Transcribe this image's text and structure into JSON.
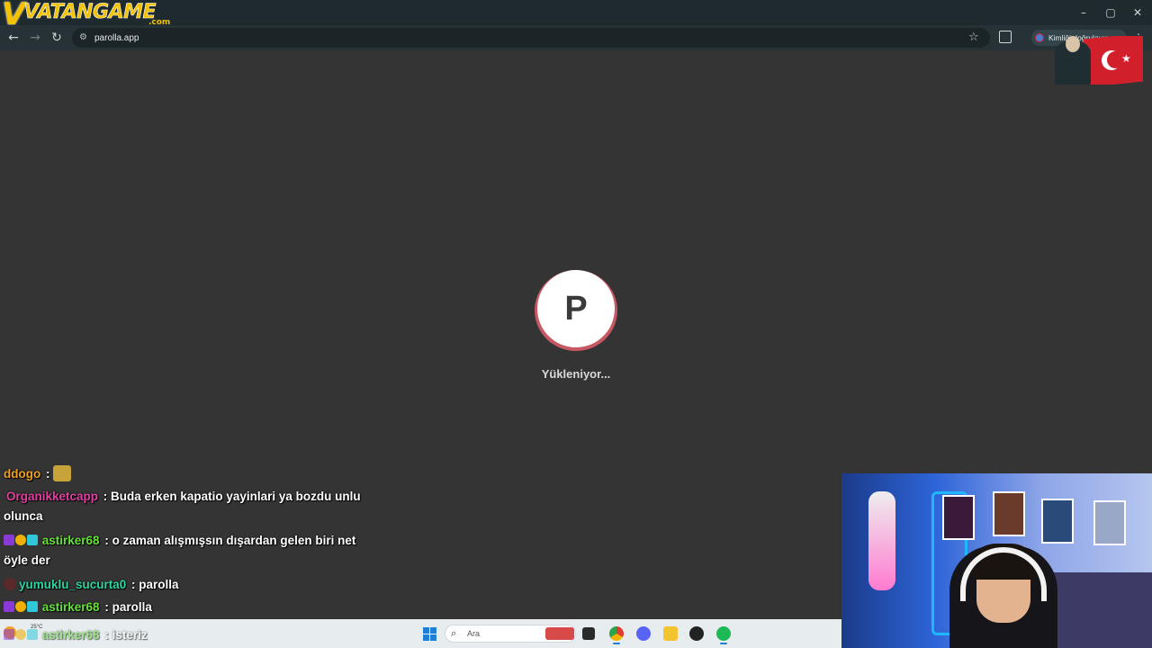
{
  "browser": {
    "logo_main": "VATANGAME",
    "logo_suffix": ".com",
    "url": "parolla.app",
    "profile_button": "Kimliği doğrulayın",
    "window_controls": [
      "–",
      "▢",
      "✕"
    ]
  },
  "page": {
    "loader_letter": "P",
    "loading_text": "Yükleniyor...",
    "loader_ring_color": "#c75863"
  },
  "chat": {
    "messages": [
      {
        "user": "ddogo",
        "text": "",
        "user_color": "#f0a020",
        "has_emote": true
      },
      {
        "user": "Organikketcapp",
        "text": "Buda erken kapatio yayinlari ya bozdu unlu olunca",
        "user_color": "#e040a0"
      },
      {
        "user": "astirker68",
        "text": "o zaman alışmışsın dışardan gelen biri net öyle der",
        "user_color": "#66e03a"
      },
      {
        "user": "yumuklu_sucurta0",
        "text": "parolla",
        "user_color": "#2fd4a0"
      },
      {
        "user": "astirker68",
        "text": "parolla",
        "user_color": "#66e03a"
      },
      {
        "user": "astirker68",
        "text": "isteriz",
        "user_color": "#66e03a"
      }
    ],
    "separator": " : "
  },
  "taskbar": {
    "search_placeholder": "Ara",
    "weather_temp": "25°C",
    "accent": "#1d7fd6"
  }
}
